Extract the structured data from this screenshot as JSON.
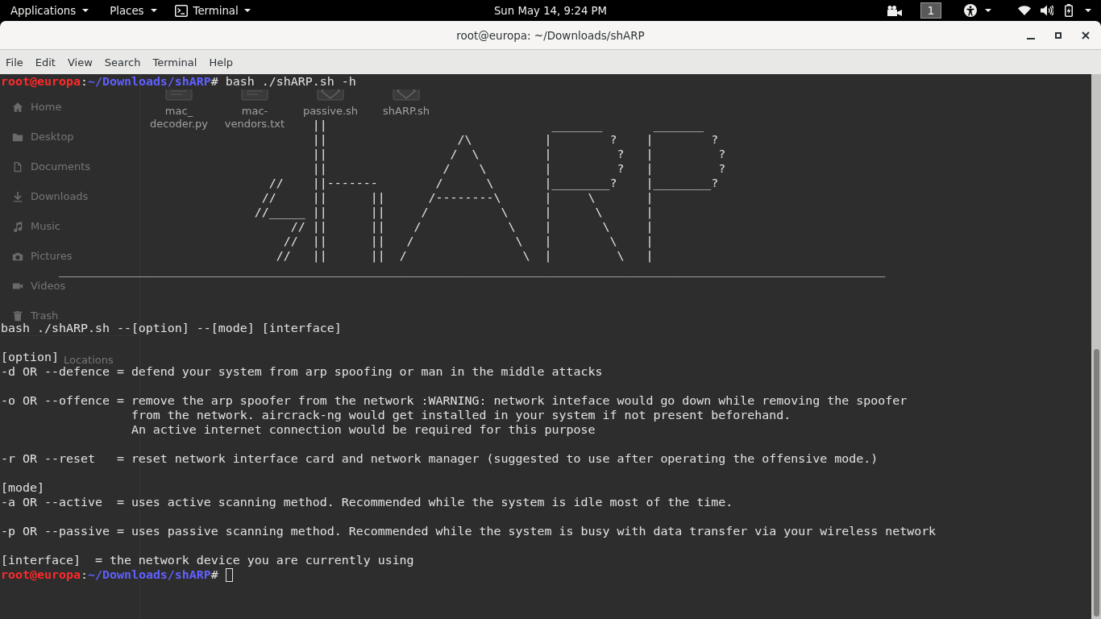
{
  "top_bar": {
    "menus": [
      {
        "label": "Applications",
        "kind": "menu"
      },
      {
        "label": "Places",
        "kind": "menu"
      },
      {
        "label": "Terminal",
        "kind": "app"
      }
    ],
    "clock": "Sun May 14, 9:24 PM",
    "workspace": "1"
  },
  "window": {
    "title": "root@europa: ~/Downloads/shARP"
  },
  "menu_bar": [
    "File",
    "Edit",
    "View",
    "Search",
    "Terminal",
    "Help"
  ],
  "file_manager": {
    "sidebar": [
      {
        "items": [
          "Home",
          "Desktop",
          "Documents",
          "Downloads",
          "Music",
          "Pictures",
          "Videos",
          "Trash"
        ]
      },
      {
        "items": [
          "Locations"
        ]
      }
    ],
    "files": [
      {
        "name": "mac_\ndecoder.py",
        "kind": "text"
      },
      {
        "name": "mac-\nvendors.txt",
        "kind": "text"
      },
      {
        "name": "passive.sh",
        "kind": "script"
      },
      {
        "name": "shARP.sh",
        "kind": "script"
      }
    ]
  },
  "terminal": {
    "lines": [
      {
        "kind": "prompt",
        "user": "root@europa",
        "separator": ":",
        "path": "~/Downloads/shARP",
        "symbol": "#",
        "command": "bash ./shARP.sh -h",
        "cursor": false
      },
      {
        "kind": "blank"
      },
      {
        "kind": "blank"
      },
      {
        "kind": "art",
        "text": "                                           ||                               _______       _______"
      },
      {
        "kind": "art",
        "text": "                                           ||                  /\\          |        ?    |        ?"
      },
      {
        "kind": "art",
        "text": "                                           ||                 /  \\         |         ?   |         ?"
      },
      {
        "kind": "art",
        "text": "                                           ||                /    \\        |         ?   |         ?"
      },
      {
        "kind": "art",
        "text": "                                     //    ||-------        /      \\       |________?    |________?"
      },
      {
        "kind": "art",
        "text": "                                    //     ||      ||      /--------\\      |     \\       |"
      },
      {
        "kind": "art",
        "text": "                                   //_____ ||      ||     /          \\     |      \\      |"
      },
      {
        "kind": "art",
        "text": "                                        // ||      ||    /            \\    |       \\     |"
      },
      {
        "kind": "art",
        "text": "                                       //  ||      ||   /              \\   |        \\    |"
      },
      {
        "kind": "art",
        "text": "                                      //   ||      ||  /                \\  |         \\   |"
      },
      {
        "kind": "art",
        "text": "        __________________________________________________________________________________________________________________"
      },
      {
        "kind": "blank"
      },
      {
        "kind": "blank"
      },
      {
        "kind": "blank"
      },
      {
        "kind": "output",
        "text": "bash ./shARP.sh --[option] --[mode] [interface]"
      },
      {
        "kind": "blank"
      },
      {
        "kind": "output",
        "text": "[option]"
      },
      {
        "kind": "output",
        "text": "-d OR --defence = defend your system from arp spoofing or man in the middle attacks"
      },
      {
        "kind": "blank"
      },
      {
        "kind": "output",
        "text": "-o OR --offence = remove the arp spoofer from the network :WARNING: network inteface would go down while removing the spoofer"
      },
      {
        "kind": "output",
        "text": "                  from the network. aircrack-ng would get installed in your system if not present beforehand."
      },
      {
        "kind": "output",
        "text": "                  An active internet connection would be required for this purpose"
      },
      {
        "kind": "blank"
      },
      {
        "kind": "output",
        "text": "-r OR --reset   = reset network interface card and network manager (suggested to use after operating the offensive mode.)"
      },
      {
        "kind": "blank"
      },
      {
        "kind": "output",
        "text": "[mode]"
      },
      {
        "kind": "output",
        "text": "-a OR --active  = uses active scanning method. Recommended while the system is idle most of the time."
      },
      {
        "kind": "blank"
      },
      {
        "kind": "output",
        "text": "-p OR --passive = uses passive scanning method. Recommended while the system is busy with data transfer via your wireless network"
      },
      {
        "kind": "blank"
      },
      {
        "kind": "output",
        "text": "[interface]  = the network device you are currently using"
      },
      {
        "kind": "prompt",
        "user": "root@europa",
        "separator": ":",
        "path": "~/Downloads/shARP",
        "symbol": "#",
        "cursor": true
      }
    ]
  }
}
